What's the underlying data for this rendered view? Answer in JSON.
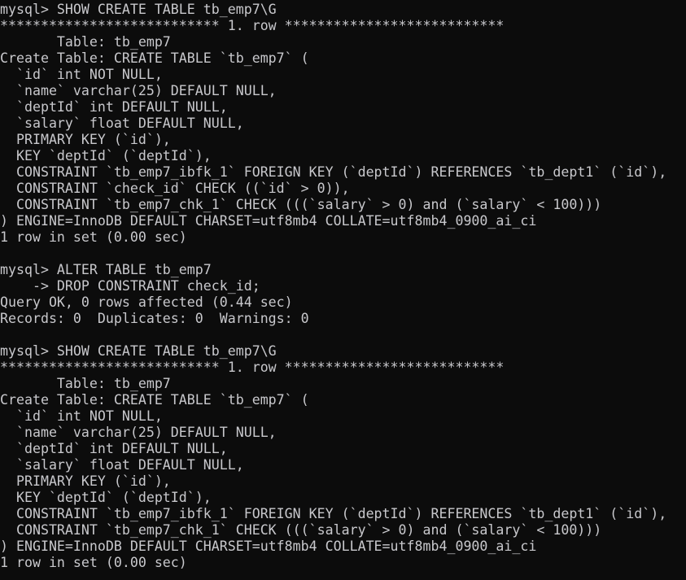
{
  "terminal": {
    "app": "mysql-client-terminal",
    "background_color": "#0c0c0c",
    "foreground_color": "#c8c8cc",
    "prompt": "mysql>",
    "continuation_prompt": "    ->",
    "columns": 84,
    "rows": 36,
    "lines": [
      "mysql> SHOW CREATE TABLE tb_emp7\\G",
      "*************************** 1. row ***************************",
      "       Table: tb_emp7",
      "Create Table: CREATE TABLE `tb_emp7` (",
      "  `id` int NOT NULL,",
      "  `name` varchar(25) DEFAULT NULL,",
      "  `deptId` int DEFAULT NULL,",
      "  `salary` float DEFAULT NULL,",
      "  PRIMARY KEY (`id`),",
      "  KEY `deptId` (`deptId`),",
      "  CONSTRAINT `tb_emp7_ibfk_1` FOREIGN KEY (`deptId`) REFERENCES `tb_dept1` (`id`),",
      "  CONSTRAINT `check_id` CHECK ((`id` > 0)),",
      "  CONSTRAINT `tb_emp7_chk_1` CHECK (((`salary` > 0) and (`salary` < 100)))",
      ") ENGINE=InnoDB DEFAULT CHARSET=utf8mb4 COLLATE=utf8mb4_0900_ai_ci",
      "1 row in set (0.00 sec)",
      "",
      "mysql> ALTER TABLE tb_emp7",
      "    -> DROP CONSTRAINT check_id;",
      "Query OK, 0 rows affected (0.44 sec)",
      "Records: 0  Duplicates: 0  Warnings: 0",
      "",
      "mysql> SHOW CREATE TABLE tb_emp7\\G",
      "*************************** 1. row ***************************",
      "       Table: tb_emp7",
      "Create Table: CREATE TABLE `tb_emp7` (",
      "  `id` int NOT NULL,",
      "  `name` varchar(25) DEFAULT NULL,",
      "  `deptId` int DEFAULT NULL,",
      "  `salary` float DEFAULT NULL,",
      "  PRIMARY KEY (`id`),",
      "  KEY `deptId` (`deptId`),",
      "  CONSTRAINT `tb_emp7_ibfk_1` FOREIGN KEY (`deptId`) REFERENCES `tb_dept1` (`id`),",
      "  CONSTRAINT `tb_emp7_chk_1` CHECK (((`salary` > 0) and (`salary` < 100)))",
      ") ENGINE=InnoDB DEFAULT CHARSET=utf8mb4 COLLATE=utf8mb4_0900_ai_ci",
      "1 row in set (0.00 sec)"
    ],
    "commands": [
      {
        "index": 0,
        "prompt": "mysql>",
        "text": "SHOW CREATE TABLE tb_emp7\\G",
        "result_status": "1 row in set (0.00 sec)"
      },
      {
        "index": 1,
        "prompt": "mysql>",
        "text": "ALTER TABLE tb_emp7",
        "continuation": "DROP CONSTRAINT check_id;",
        "result_status": "Query OK, 0 rows affected (0.44 sec)",
        "result_detail": "Records: 0  Duplicates: 0  Warnings: 0"
      },
      {
        "index": 2,
        "prompt": "mysql>",
        "text": "SHOW CREATE TABLE tb_emp7\\G",
        "result_status": "1 row in set (0.00 sec)"
      }
    ],
    "table": {
      "name": "tb_emp7",
      "engine": "InnoDB",
      "charset": "utf8mb4",
      "collate": "utf8mb4_0900_ai_ci",
      "columns": [
        {
          "name": "id",
          "type": "int",
          "nullable": "NOT NULL"
        },
        {
          "name": "name",
          "type": "varchar(25)",
          "nullable": "DEFAULT NULL"
        },
        {
          "name": "deptId",
          "type": "int",
          "nullable": "DEFAULT NULL"
        },
        {
          "name": "salary",
          "type": "float",
          "nullable": "DEFAULT NULL"
        }
      ],
      "keys": [
        "PRIMARY KEY (`id`)",
        "KEY `deptId` (`deptId`)"
      ],
      "constraints_before": [
        "CONSTRAINT `tb_emp7_ibfk_1` FOREIGN KEY (`deptId`) REFERENCES `tb_dept1` (`id`)",
        "CONSTRAINT `check_id` CHECK ((`id` > 0))",
        "CONSTRAINT `tb_emp7_chk_1` CHECK (((`salary` > 0) and (`salary` < 100)))"
      ],
      "constraints_after": [
        "CONSTRAINT `tb_emp7_ibfk_1` FOREIGN KEY (`deptId`) REFERENCES `tb_dept1` (`id`)",
        "CONSTRAINT `tb_emp7_chk_1` CHECK (((`salary` > 0) and (`salary` < 100)))"
      ],
      "dropped_constraint": "check_id"
    }
  }
}
